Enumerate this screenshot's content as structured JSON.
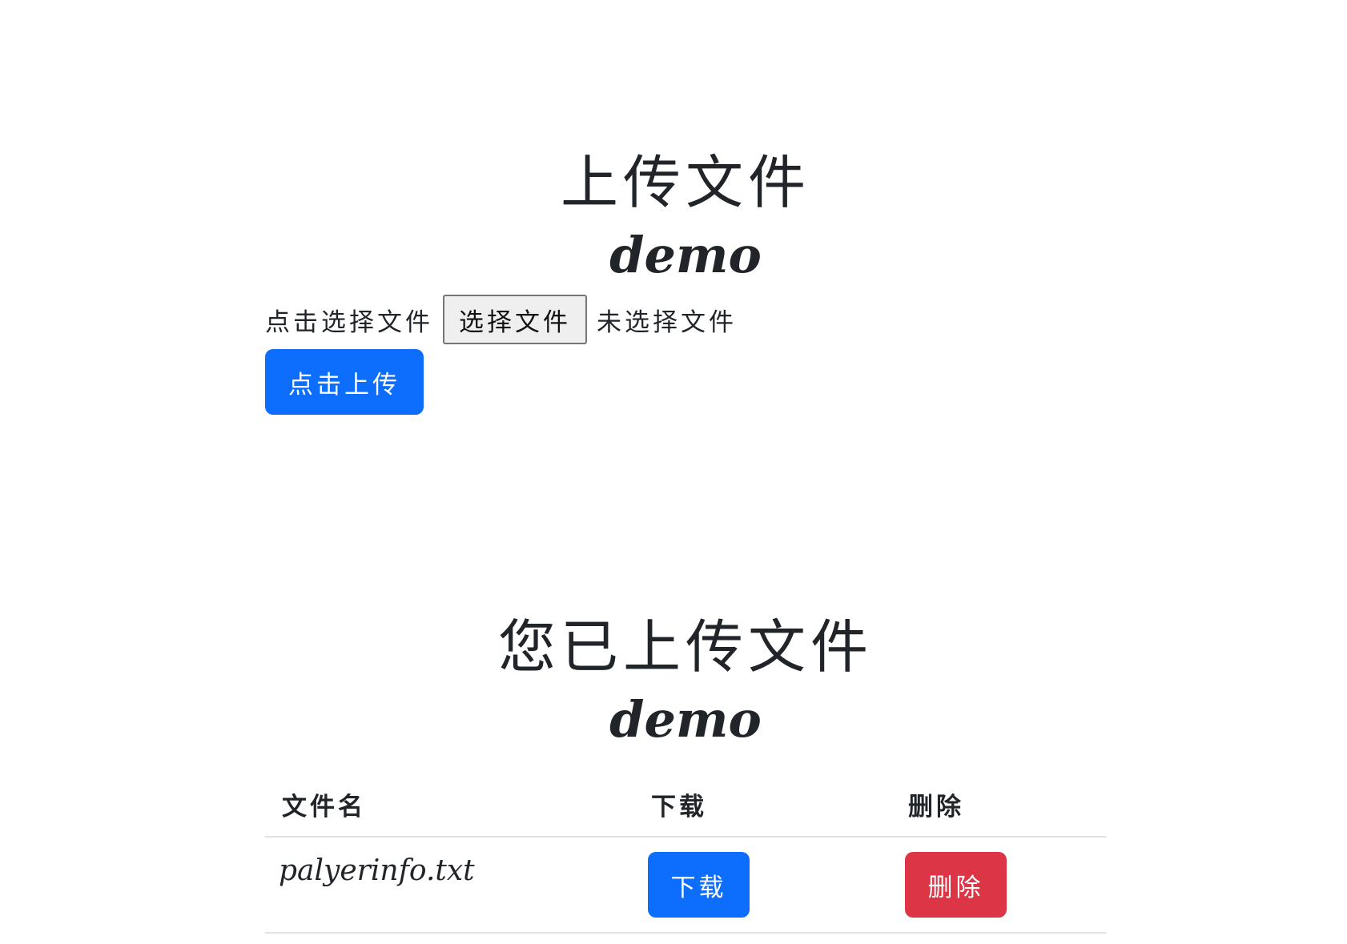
{
  "upload": {
    "title": "上传文件",
    "subtitle": "demo",
    "picker_label": "点击选择文件",
    "choose_button": "选择文件",
    "no_file_text": "未选择文件",
    "upload_button": "点击上传"
  },
  "files": {
    "title": "您已上传文件",
    "subtitle": "demo",
    "columns": {
      "name": "文件名",
      "download": "下载",
      "delete": "删除"
    },
    "rows": [
      {
        "name": "palyerinfo.txt",
        "download_label": "下载",
        "delete_label": "删除"
      }
    ]
  },
  "colors": {
    "primary": "#0d6efd",
    "danger": "#dc3545",
    "text": "#212529"
  }
}
